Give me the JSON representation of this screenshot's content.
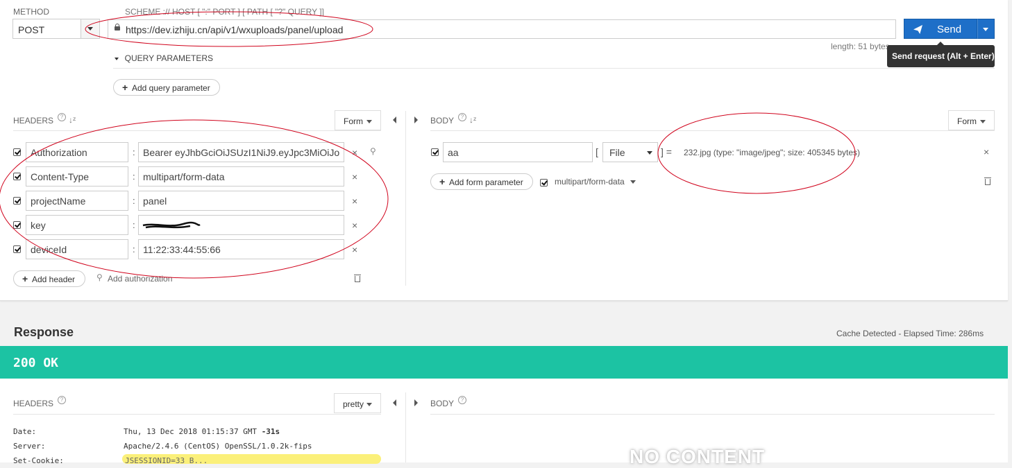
{
  "request": {
    "method_label": "METHOD",
    "method_value": "POST",
    "url_label": "SCHEME :// HOST [ \":\" PORT ] [ PATH [ \"?\" QUERY ]]",
    "url_value": "https://dev.izhiju.cn/api/v1/wxuploads/panel/upload",
    "send_label": "Send",
    "length_text": "length: 51 bytes",
    "tooltip": "Send request (Alt + Enter)",
    "query_params_label": "QUERY PARAMETERS",
    "add_query_param_label": "Add query parameter"
  },
  "headers_section": {
    "title": "HEADERS",
    "mode": "Form",
    "rows": [
      {
        "key": "Authorization",
        "value": "Bearer eyJhbGciOiJSUzI1NiJ9.eyJpc3MiOiJo",
        "checked": true
      },
      {
        "key": "Content-Type",
        "value": "multipart/form-data",
        "checked": true
      },
      {
        "key": "projectName",
        "value": "panel",
        "checked": true
      },
      {
        "key": "key",
        "value": "",
        "checked": true
      },
      {
        "key": "deviceId",
        "value": "11:22:33:44:55:66",
        "checked": true
      }
    ],
    "add_header_label": "Add header",
    "add_auth_label": "Add authorization"
  },
  "body_section": {
    "title": "BODY",
    "mode": "Form",
    "param_name": "aa",
    "param_type": "File",
    "file_info": "232.jpg (type: \"image/jpeg\"; size: 405345 bytes)",
    "add_form_param_label": "Add form parameter",
    "encoding": "multipart/form-data"
  },
  "response": {
    "title": "Response",
    "cache_text": "Cache Detected - Elapsed Time: 286ms",
    "status": "200 OK",
    "headers_title": "HEADERS",
    "headers_mode": "pretty",
    "body_title": "BODY",
    "no_content": "NO CONTENT",
    "header_rows": [
      {
        "key": "Date:",
        "value": "Thu, 13 Dec 2018 01:15:37 GMT",
        "extra": "-31s"
      },
      {
        "key": "Server:",
        "value": "Apache/2.4.6 (CentOS) OpenSSL/1.0.2k-fips",
        "extra": ""
      },
      {
        "key": "Set-Cookie:",
        "value": "JSESSIONID=33 B... ",
        "extra": ""
      }
    ]
  },
  "colors": {
    "accent": "#1e6fc8",
    "status_bg": "#1cc3a3",
    "annotation": "#d0021b"
  }
}
